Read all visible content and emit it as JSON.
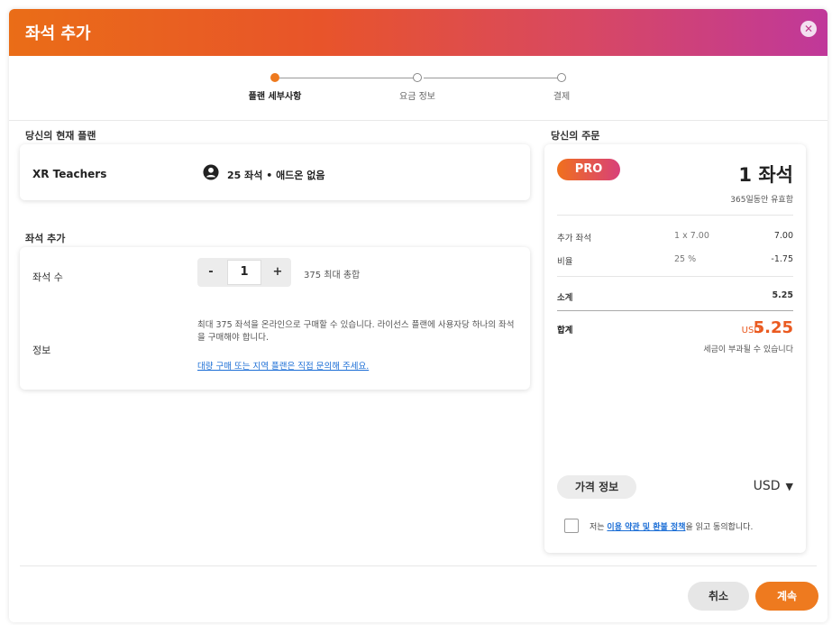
{
  "header": {
    "title": "좌석 추가",
    "close_icon": "close-icon"
  },
  "steps": [
    {
      "label": "플랜 세부사항",
      "active": true
    },
    {
      "label": "요금 정보",
      "active": false
    },
    {
      "label": "결제",
      "active": false
    }
  ],
  "current_plan": {
    "section_title": "당신의 현재 플랜",
    "name": "XR Teachers",
    "icon": "user-circle-icon",
    "info": "25 좌석 • 애드온 없음"
  },
  "add_seats": {
    "section_title": "좌석 추가",
    "seat_label": "좌석 수",
    "minus": "-",
    "quantity": "1",
    "plus": "+",
    "max_total": "375 최대 총합",
    "info_label": "정보",
    "info_text": "최대 375 좌석을 온라인으로 구매할 수 있습니다. 라이선스 플랜에 사용자당 하나의 좌석을 구매해야 합니다.",
    "info_link": "대량 구매 또는 지역 플랜은 직접 문의해 주세요."
  },
  "order": {
    "section_title": "당신의 주문",
    "badge": "PRO",
    "seat_count": "1 좌석",
    "validity": "365일동안 유효함",
    "lines": [
      {
        "label": "추가 좌석",
        "mid": "1  x  7.00",
        "value": "7.00"
      },
      {
        "label": "비율",
        "mid": "25  %",
        "value": "-1.75"
      }
    ],
    "subtotal_label": "소계",
    "subtotal_value": "5.25",
    "total_label": "합계",
    "total_currency": "USD",
    "total_amount": "5.25",
    "tax_note": "세금이 부과될 수 있습니다",
    "price_info_button": "가격 정보",
    "currency": "USD",
    "agree_prefix": "저는 ",
    "agree_link": "이용 약관 및 환불 정책",
    "agree_suffix": "을 읽고 동의합니다."
  },
  "footer": {
    "cancel": "취소",
    "continue": "계속"
  },
  "colors": {
    "accent": "#ee7a1f",
    "link": "#1d6fd6",
    "header_start": "#ea6d17",
    "header_end": "#c0389a"
  }
}
